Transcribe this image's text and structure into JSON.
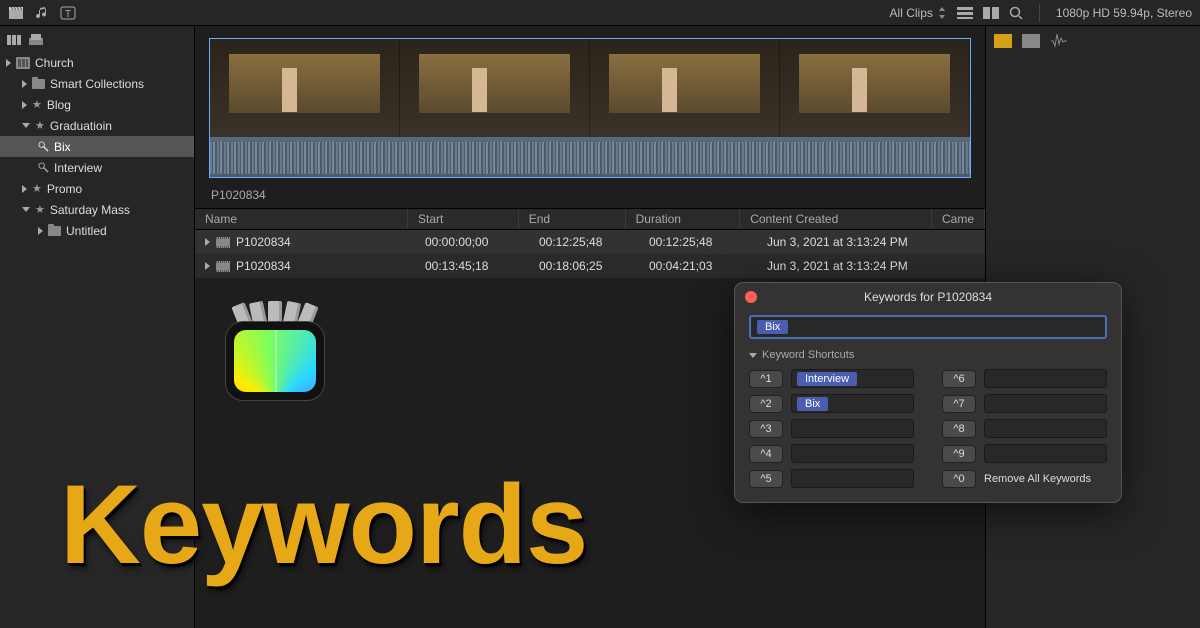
{
  "toolbar": {
    "clip_filter": "All Clips",
    "format_info": "1080p HD 59.94p, Stereo"
  },
  "sidebar": {
    "library": "Church",
    "items": [
      {
        "label": "Smart Collections"
      },
      {
        "label": "Blog"
      },
      {
        "label": "Graduatioin"
      },
      {
        "label": "Bix"
      },
      {
        "label": "Interview"
      },
      {
        "label": "Promo"
      },
      {
        "label": "Saturday Mass"
      },
      {
        "label": "Untitled"
      }
    ]
  },
  "clip": {
    "name": "P1020834"
  },
  "table": {
    "headers": {
      "name": "Name",
      "start": "Start",
      "end": "End",
      "dur": "Duration",
      "cc": "Content Created",
      "cam": "Came"
    },
    "rows": [
      {
        "name": "P1020834",
        "start": "00:00:00;00",
        "end": "00:12:25;48",
        "dur": "00:12:25;48",
        "cc": "Jun 3, 2021 at 3:13:24 PM"
      },
      {
        "name": "P1020834",
        "start": "00:13:45;18",
        "end": "00:18:06;25",
        "dur": "00:04:21;03",
        "cc": "Jun 3, 2021 at 3:13:24 PM"
      }
    ]
  },
  "popover": {
    "title": "Keywords for P1020834",
    "current_tag": "Bix",
    "section": "Keyword Shortcuts",
    "slots": [
      {
        "key": "^1",
        "tag": "Interview"
      },
      {
        "key": "^6",
        "tag": ""
      },
      {
        "key": "^2",
        "tag": "Bix"
      },
      {
        "key": "^7",
        "tag": ""
      },
      {
        "key": "^3",
        "tag": ""
      },
      {
        "key": "^8",
        "tag": ""
      },
      {
        "key": "^4",
        "tag": ""
      },
      {
        "key": "^9",
        "tag": ""
      },
      {
        "key": "^5",
        "tag": ""
      },
      {
        "key": "^0",
        "label": "Remove All Keywords"
      }
    ]
  },
  "overlay": {
    "text": "Keywords"
  }
}
